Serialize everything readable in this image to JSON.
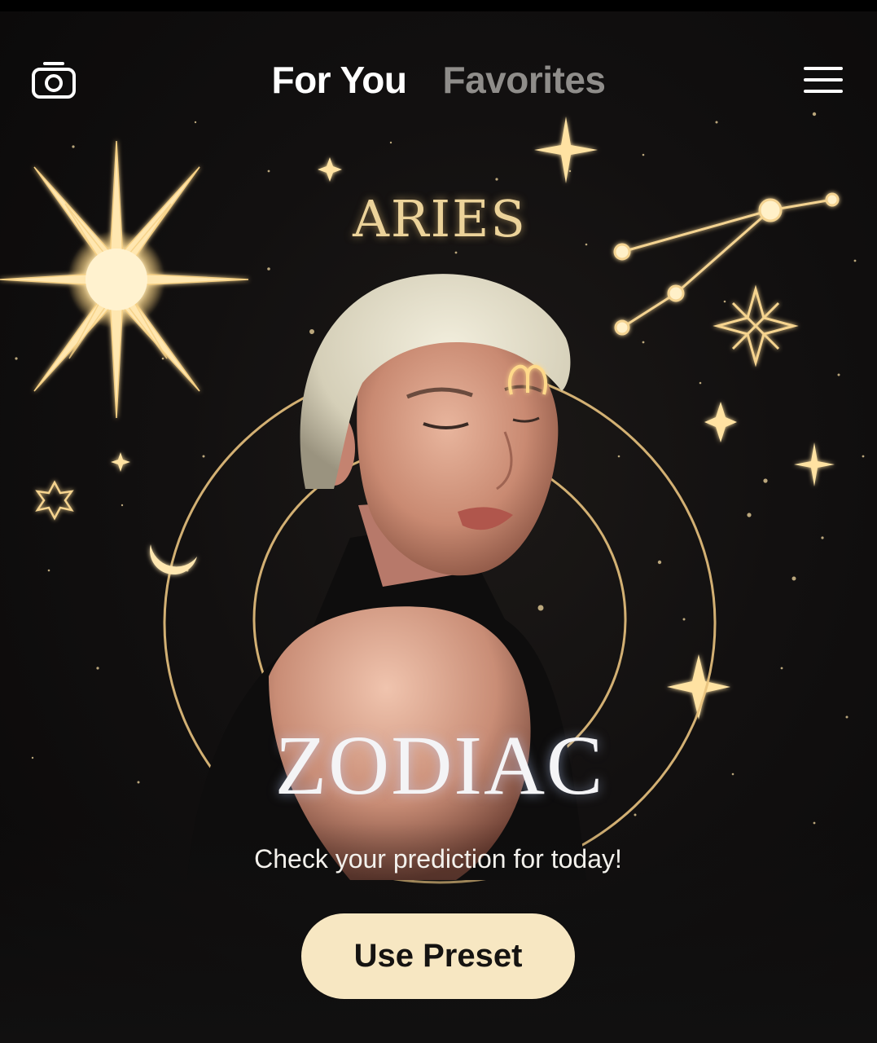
{
  "header": {
    "tabs": [
      {
        "label": "For You",
        "active": true
      },
      {
        "label": "Favorites",
        "active": false
      }
    ],
    "left_icon": "camera-icon",
    "right_icon": "hamburger-menu-icon"
  },
  "preset": {
    "sign_title": "ARIES",
    "headline": "ZODIAC",
    "subtitle": "Check your prediction for today!",
    "button_label": "Use Preset"
  },
  "colors": {
    "background": "#0b0a0a",
    "gold": "#ecd39a",
    "button_fill": "#f7e7c2",
    "tab_active": "#ffffff",
    "tab_inactive": "#8f8d8a"
  }
}
